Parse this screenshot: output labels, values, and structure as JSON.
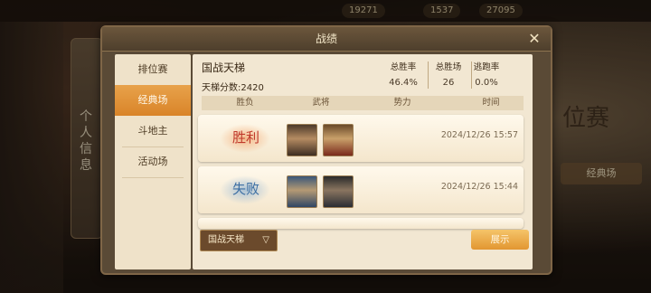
{
  "background": {
    "topbar_values": [
      "19271",
      "1537",
      "27095"
    ],
    "left_panel_text": "个人信息",
    "right_big_text": "位赛",
    "right_button": "经典场"
  },
  "dialog": {
    "title": "战绩",
    "close_icon": "close-icon"
  },
  "menu": {
    "items": [
      {
        "label": "排位赛",
        "active": false
      },
      {
        "label": "经典场",
        "active": true
      },
      {
        "label": "斗地主",
        "active": false
      },
      {
        "label": "活动场",
        "active": false
      }
    ]
  },
  "panel": {
    "mode_title": "国战天梯",
    "score_label": "天梯分数:2420",
    "stats": [
      {
        "label": "总胜率",
        "value": "46.4%"
      },
      {
        "label": "总胜场",
        "value": "26"
      },
      {
        "label": "逃跑率",
        "value": "0.0%"
      }
    ],
    "columns": [
      "胜负",
      "武将",
      "势力",
      "时间"
    ],
    "rows": [
      {
        "result": "胜利",
        "time": "2024/12/26  15:57",
        "result_color": "#c0392b"
      },
      {
        "result": "失败",
        "time": "2024/12/26  15:44",
        "result_color": "#3d6fa3"
      }
    ]
  },
  "footer": {
    "dropdown_value": "国战天梯",
    "show_button": "展示"
  },
  "colors": {
    "accent": "#e29631",
    "win": "#c0392b",
    "lose": "#3d6fa3"
  }
}
